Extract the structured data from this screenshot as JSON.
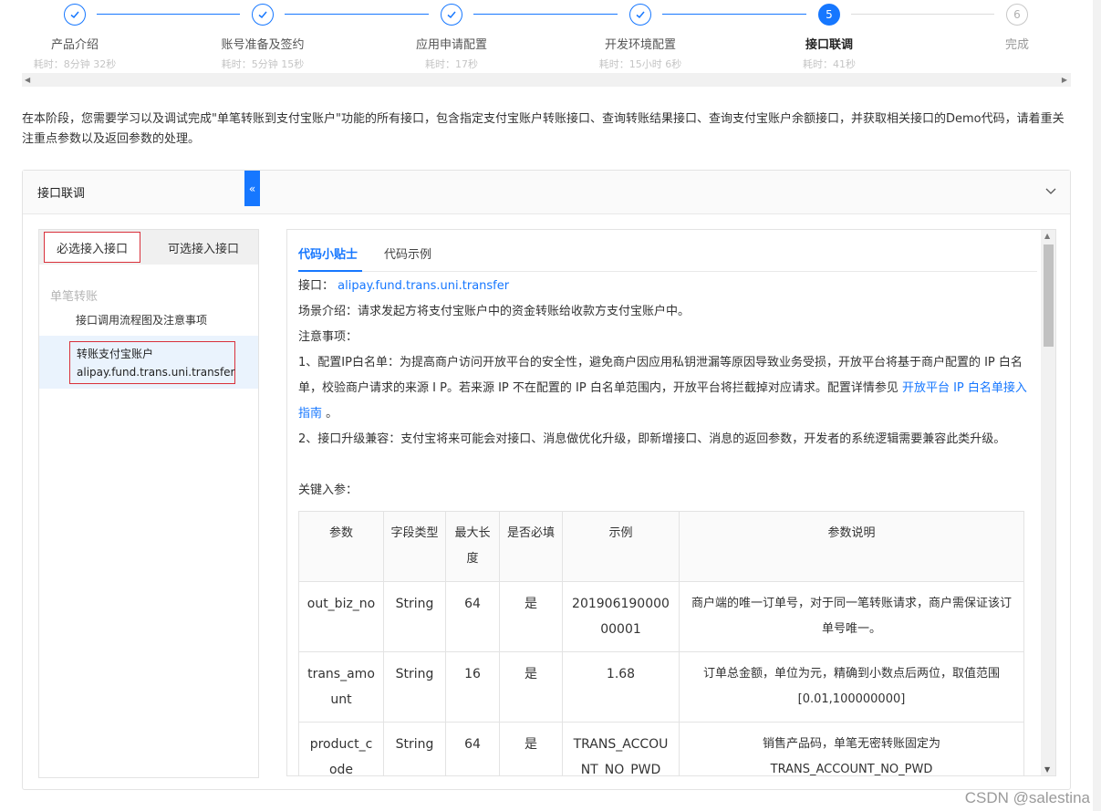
{
  "steps": [
    {
      "title": "产品介绍",
      "time": "耗时：8分钟 32秒",
      "state": "done"
    },
    {
      "title": "账号准备及签约",
      "time": "耗时：5分钟 15秒",
      "state": "done"
    },
    {
      "title": "应用申请配置",
      "time": "耗时：17秒",
      "state": "done"
    },
    {
      "title": "开发环境配置",
      "time": "耗时：15小时 6秒",
      "state": "done"
    },
    {
      "title": "接口联调",
      "time": "耗时：41秒",
      "state": "active",
      "number": "5"
    },
    {
      "title": "完成",
      "time": "",
      "state": "pending",
      "number": "6"
    }
  ],
  "intro": "在本阶段，您需要学习以及调试完成\"单笔转账到支付宝账户\"功能的所有接口，包含指定支付宝账户转账接口、查询转账结果接口、查询支付宝账户余额接口，并获取相关接口的Demo代码，请着重关注重点参数以及返回参数的处理。",
  "panel": {
    "title": "接口联调",
    "left": {
      "tab_required": "必选接入接口",
      "tab_optional": "可选接入接口",
      "collapse_glyph": "«",
      "group": "单笔转账",
      "item1": "接口调用流程图及注意事项",
      "item2_line1": "转账支付宝账户",
      "item2_line2": "alipay.fund.trans.uni.transfer"
    },
    "right": {
      "tab_tips": "代码小贴士",
      "tab_example": "代码示例",
      "api_label": "接口：",
      "api_name": "alipay.fund.trans.uni.transfer",
      "scene": "场景介绍：请求发起方将支付宝账户中的资金转账给收款方支付宝账户中。",
      "notice_title": "注意事项：",
      "notice1_part1": "1、配置IP白名单：为提高商户访问开放平台的安全性，避免商户因应用私钥泄漏等原因导致业务受损，开放平台将基于商户配置的 IP 白名单，校验商户请求的来源 I P。若来源 IP 不在配置的 IP 白名单范围内，开放平台将拦截掉对应请求。配置详情参见 ",
      "notice1_link": "开放平台 IP 白名单接入指南",
      "notice1_end": " 。",
      "notice2": "2、接口升级兼容：支付宝将来可能会对接口、消息做优化升级，即新增接口、消息的返回参数，开发者的系统逻辑需要兼容此类升级。",
      "key_params": "关键入参：",
      "table_headers": [
        "参数",
        "字段类型",
        "最大长度",
        "是否必填",
        "示例",
        "参数说明"
      ],
      "rows": [
        [
          "out_biz_no",
          "String",
          "64",
          "是",
          "20190619000000001",
          "商户端的唯一订单号，对于同一笔转账请求，商户需保证该订单号唯一。"
        ],
        [
          "trans_amount",
          "String",
          "16",
          "是",
          "1.68",
          "订单总金额，单位为元，精确到小数点后两位，取值范围[0.01,100000000]"
        ],
        [
          "product_code",
          "String",
          "64",
          "是",
          "TRANS_ACCOUNT_NO_PWD",
          "销售产品码，单笔无密转账固定为TRANS_ACCOUNT_NO_PWD"
        ]
      ]
    }
  },
  "watermark": "CSDN @salestina"
}
